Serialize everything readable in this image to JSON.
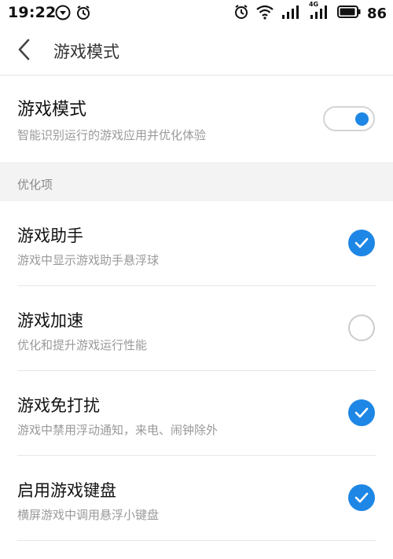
{
  "status_bar": {
    "time": "19:22",
    "battery": "86",
    "network_badge": "4G",
    "left_icons": [
      "navigation-icon",
      "alarm-icon"
    ],
    "right_icons": [
      "alarm-icon",
      "wifi-icon",
      "signal-icon",
      "signal-4g-icon",
      "battery-icon"
    ]
  },
  "header": {
    "title": "游戏模式",
    "back_icon": "chevron-left-icon"
  },
  "main_setting": {
    "title": "游戏模式",
    "subtitle": "智能识别运行的游戏应用并优化体验",
    "enabled": true
  },
  "section": {
    "label": "优化项"
  },
  "items": [
    {
      "title": "游戏助手",
      "subtitle": "游戏中显示游戏助手悬浮球",
      "checked": true
    },
    {
      "title": "游戏加速",
      "subtitle": "优化和提升游戏运行性能",
      "checked": false
    },
    {
      "title": "游戏免打扰",
      "subtitle": "游戏中禁用浮动通知，来电、闹钟除外",
      "checked": true
    },
    {
      "title": "启用游戏键盘",
      "subtitle": "横屏游戏中调用悬浮小键盘",
      "checked": true
    }
  ],
  "colors": {
    "accent": "#1e87e5",
    "divider": "#e6e6e6",
    "section_bg": "#f3f3f3",
    "subtitle": "#9a9a9a"
  }
}
